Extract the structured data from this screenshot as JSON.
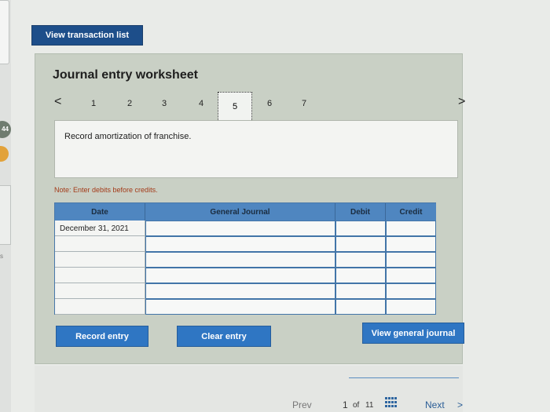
{
  "top_button": "View transaction list",
  "worksheet": {
    "title": "Journal entry worksheet",
    "prev_symbol": "<",
    "next_symbol": ">",
    "steps": [
      "1",
      "2",
      "3",
      "4",
      "5",
      "6",
      "7"
    ],
    "active_step": "5",
    "description": "Record amortization of franchise.",
    "note": "Note: Enter debits before credits."
  },
  "table": {
    "columns": [
      "Date",
      "General Journal",
      "Debit",
      "Credit"
    ],
    "rows": [
      [
        "December 31, 2021",
        "",
        "",
        ""
      ],
      [
        "",
        "",
        "",
        ""
      ],
      [
        "",
        "",
        "",
        ""
      ],
      [
        "",
        "",
        "",
        ""
      ],
      [
        "",
        "",
        "",
        ""
      ],
      [
        "",
        "",
        "",
        ""
      ]
    ]
  },
  "actions": {
    "record": "Record entry",
    "clear": "Clear entry",
    "view_journal": "View general journal"
  },
  "pagination": {
    "prev": "Prev",
    "current": "1",
    "of": "of",
    "total": "11",
    "next": "Next",
    "next_symbol": ">"
  },
  "sidebar": {
    "badge": "44",
    "fragment": "s"
  },
  "colors": {
    "primary_dark": "#1d4e8a",
    "primary": "#2f76c3",
    "panel": "#c9d0c5",
    "header": "#4f86c0",
    "note": "#a33a18"
  }
}
